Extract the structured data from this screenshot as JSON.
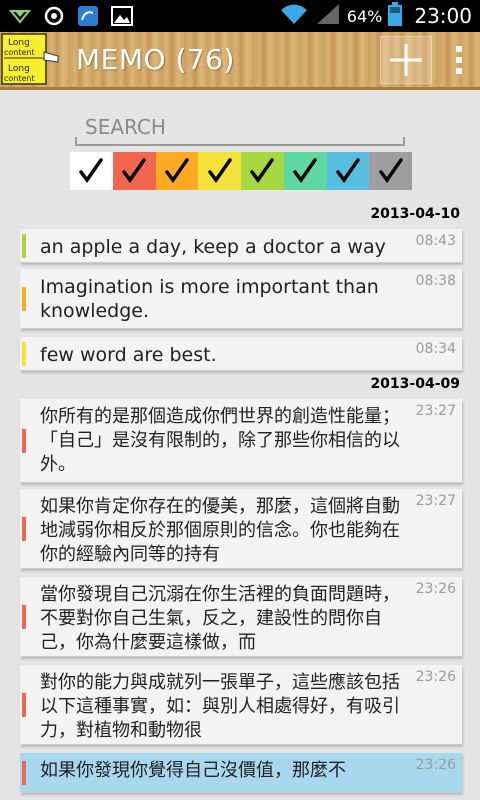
{
  "status_bar": {
    "battery_percent": "64%",
    "time": "23:00",
    "icons": [
      "download-arrow-icon",
      "sync-icon",
      "app-notification-icon",
      "gallery-icon",
      "wifi-icon",
      "signal-icon",
      "battery-icon"
    ]
  },
  "action_bar": {
    "title": "MEMO (76)",
    "app_icon_text": [
      "Long content",
      "Long content"
    ],
    "add_icon": "plus-icon",
    "overflow_icon": "overflow-menu-icon"
  },
  "search": {
    "placeholder": "SEARCH",
    "value": ""
  },
  "color_filter": {
    "colors": [
      "#ffffff",
      "#f0664e",
      "#ffaa22",
      "#f3e23a",
      "#a6d640",
      "#5ed8a0",
      "#58bedf",
      "#9e9e9e"
    ],
    "checked": [
      true,
      true,
      true,
      true,
      true,
      true,
      true,
      true
    ]
  },
  "groups": [
    {
      "date": "2013-04-10",
      "memos": [
        {
          "text": "an apple a day, keep a doctor a way",
          "time": "08:43",
          "color": "#a6d640"
        },
        {
          "text": "Imagination is more important than knowledge.",
          "time": "08:38",
          "color": "#ffaa22"
        },
        {
          "text": "few word are best.",
          "time": "08:34",
          "color": "#f3e23a"
        }
      ]
    },
    {
      "date": "2013-04-09",
      "memos": [
        {
          "text": "你所有的是那個造成你們世界的創造性能量；「自己」是沒有限制的，除了那些你相信的以外。",
          "time": "23:27",
          "color": "#f0664e"
        },
        {
          "text": "如果你肯定你存在的優美，那麼，這個將自動地減弱你相反於那個原則的信念。你也能夠在你的經驗內同等的持有",
          "time": "23:27",
          "color": "#f0664e"
        },
        {
          "text": "當你發現自己沉溺在你生活裡的負面問題時，不要對你自己生氣，反之，建設性的問你自己，你為什麼要這樣做，而",
          "time": "23:26",
          "color": "#f0664e"
        },
        {
          "text": "對你的能力與成就列一張單子，這些應該包括以下這種事實，如：與別人相處得好，有吸引力，對植物和動物很",
          "time": "23:26",
          "color": "#f0664e"
        },
        {
          "text": "如果你發現你覺得自己沒價值，那麼不",
          "time": "23:26",
          "color": "#f0664e"
        }
      ]
    }
  ]
}
